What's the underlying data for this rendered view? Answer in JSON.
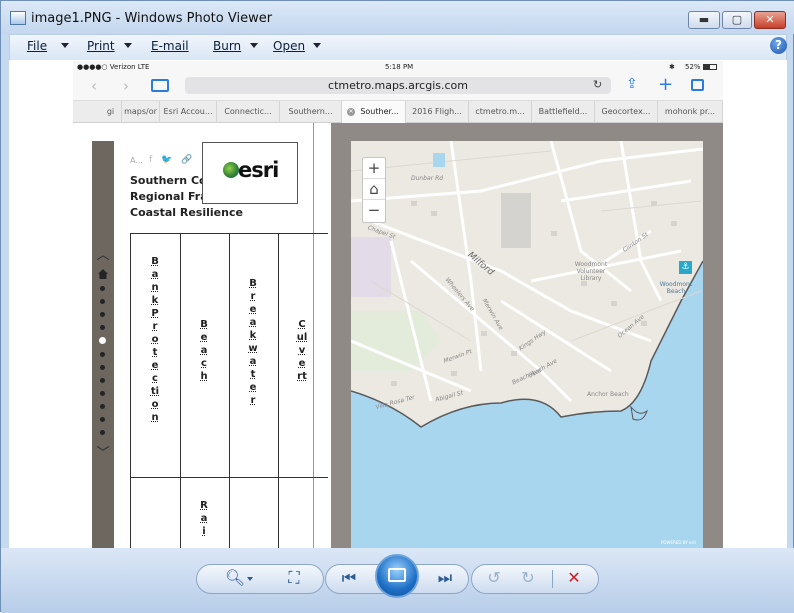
{
  "window": {
    "title": "image1.PNG - Windows Photo Viewer",
    "min_label": "▬",
    "max_label": "▢",
    "close_label": "✕"
  },
  "menu": {
    "file": "File",
    "print": "Print",
    "email": "E-mail",
    "burn": "Burn",
    "open": "Open",
    "help": "?"
  },
  "ios": {
    "carrier": "●●●●○ Verizon  LTE",
    "time": "5:18 PM",
    "battery": "52%",
    "url": "ctmetro.maps.arcgis.com",
    "tabs": [
      "gi",
      "maps/or",
      "Esri Accou...",
      "Connectic...",
      "Southern...",
      "Souther...",
      "2016 Fligh...",
      "ctmetro.m...",
      "Battlefield...",
      "Geocortex...",
      "mohonk pr..."
    ],
    "active_tab": 5
  },
  "story": {
    "author_prefix": "A...",
    "title": "Southern Connecticut Regional Framework for Coastal Resilience",
    "logo_text": "esri",
    "columns": [
      [
        "B",
        "a",
        "n",
        "k",
        "P",
        "r",
        "o",
        "t",
        "e",
        "c",
        "ti",
        "o",
        "n"
      ],
      [
        "B",
        "e",
        "a",
        "c",
        "h"
      ],
      [
        "B",
        "r",
        "e",
        "a",
        "k",
        "w",
        "a",
        "t",
        "e",
        "r"
      ],
      [
        "C",
        "ul",
        "v",
        "e",
        "rt"
      ]
    ],
    "row2_col2": [
      "R",
      "a",
      "i"
    ]
  },
  "map": {
    "zoom_in": "+",
    "zoom_out": "−",
    "labels": [
      "Dunbar Rd",
      "Chapel St",
      "Milford",
      "Woodmont Volunteer Library",
      "Woodmont Beach",
      "Wheelers Ave",
      "Anchor Beach",
      "Beach Ave",
      "Abigail St",
      "Villa Rosa Ter",
      "Merwin Ave",
      "Ocean Ave",
      "Merwin Pt",
      "Kings Hwy",
      "Clinton St",
      "Beach Ave"
    ],
    "credit": "POWERED BY esri"
  },
  "toolbar": {
    "zoom": "🔍︎",
    "fit": "⛶",
    "prev": "⏮",
    "next": "⏭",
    "rotl": "↺",
    "rotr": "↻",
    "delete": "✕"
  }
}
